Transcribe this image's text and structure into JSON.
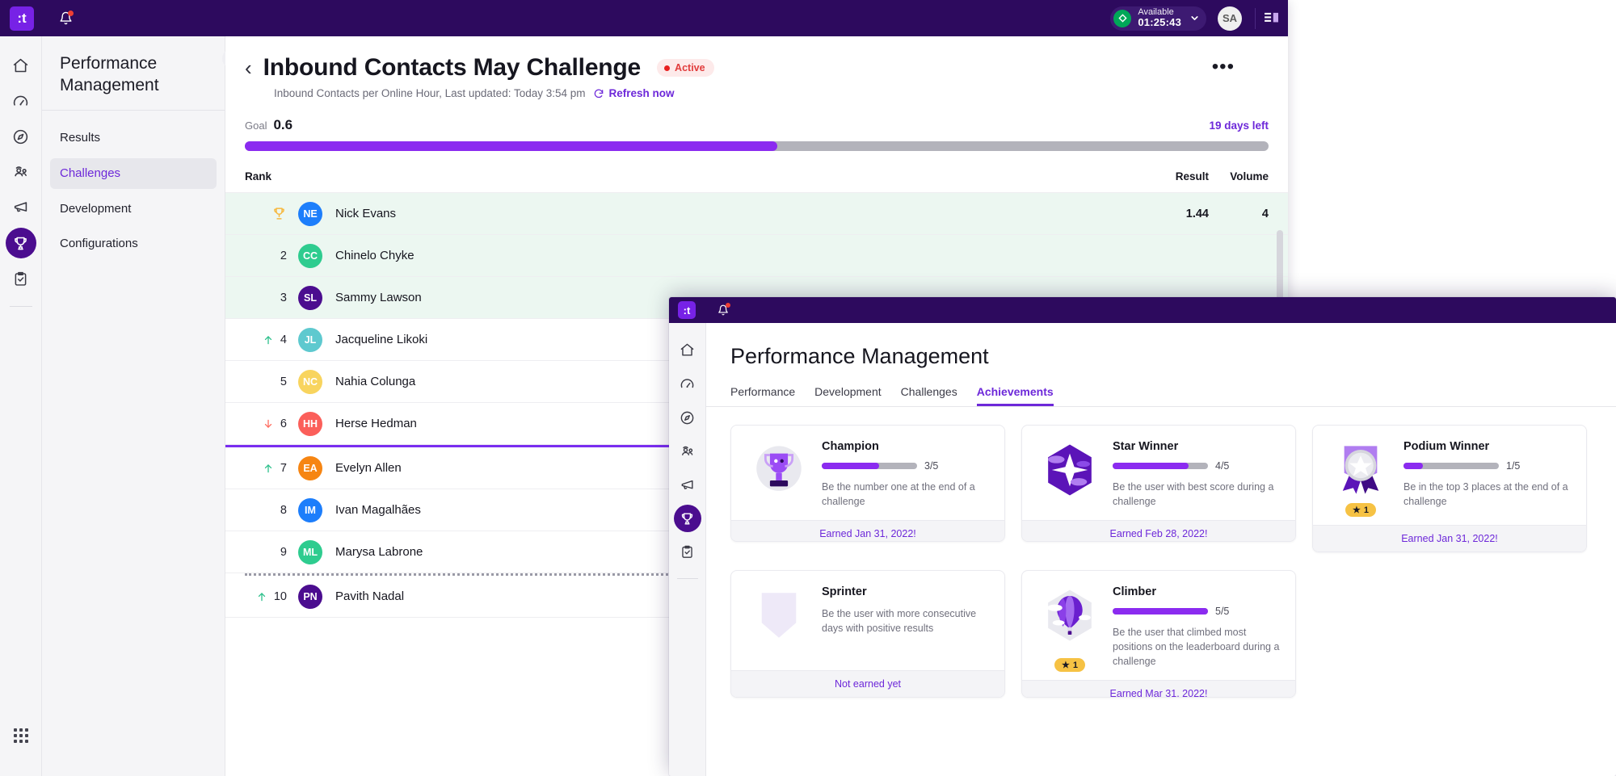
{
  "window1": {
    "topbar": {
      "logo_text": ":t",
      "notifications_icon": "bell-icon",
      "status": {
        "label": "Available",
        "time": "01:25:43",
        "chevron": "chevron-down-icon"
      },
      "avatar_initials": "SA",
      "panel_toggle_icon": "panel-toggle-icon"
    },
    "rail_icons": [
      "home-icon",
      "gauge-icon",
      "compass-icon",
      "people-icon",
      "megaphone-icon",
      "trophy-icon",
      "clipboard-check-icon",
      "apps-grid-icon"
    ],
    "sidebar": {
      "title": "Performance Management",
      "collapse_icon": "collapse-left-icon",
      "items": [
        {
          "label": "Results",
          "selected": false
        },
        {
          "label": "Challenges",
          "selected": true
        },
        {
          "label": "Development",
          "selected": false
        },
        {
          "label": "Configurations",
          "selected": false
        }
      ]
    },
    "header": {
      "back_icon": "chevron-left-icon",
      "title": "Inbound Contacts May Challenge",
      "status_badge": "Active",
      "subtitle": "Inbound Contacts per Online Hour, Last updated: Today 3:54 pm",
      "refresh_label": "Refresh now",
      "refresh_icon": "refresh-icon",
      "more_icon": "more-options-icon"
    },
    "goal": {
      "label": "Goal",
      "value": "0.6",
      "days_left": "19 days left",
      "progress_percent": 52
    },
    "leaderboard": {
      "columns": {
        "rank": "Rank",
        "result": "Result",
        "volume": "Volume"
      },
      "rows": [
        {
          "rank": "1",
          "trend": "trophy",
          "initials": "NE",
          "color": "#1d7efb",
          "name": "Nick Evans",
          "result": "1.44",
          "volume": "4",
          "top3": true
        },
        {
          "rank": "2",
          "trend": "none",
          "initials": "CC",
          "color": "#2ecc8f",
          "name": "Chinelo Chyke",
          "result": "",
          "volume": "",
          "top3": true
        },
        {
          "rank": "3",
          "trend": "none",
          "initials": "SL",
          "color": "#4b0d8f",
          "name": "Sammy Lawson",
          "result": "",
          "volume": "",
          "top3": true
        },
        {
          "rank": "4",
          "trend": "up",
          "initials": "JL",
          "color": "#5ec9cf",
          "name": "Jacqueline Likoki",
          "result": "",
          "volume": "",
          "top3": false
        },
        {
          "rank": "5",
          "trend": "none",
          "initials": "NC",
          "color": "#f8d45e",
          "name": "Nahia Colunga",
          "result": "",
          "volume": "",
          "top3": false
        },
        {
          "rank": "6",
          "trend": "down",
          "initials": "HH",
          "color": "#fb5f5a",
          "name": "Herse Hedman",
          "result": "",
          "volume": "",
          "top3": false
        },
        {
          "rank": "7",
          "trend": "up",
          "initials": "EA",
          "color": "#f68512",
          "name": "Evelyn Allen",
          "result": "",
          "volume": "",
          "top3": false
        },
        {
          "rank": "8",
          "trend": "none",
          "initials": "IM",
          "color": "#1d7efb",
          "name": "Ivan Magalhães",
          "result": "",
          "volume": "",
          "top3": false
        },
        {
          "rank": "9",
          "trend": "none",
          "initials": "ML",
          "color": "#2ecc8f",
          "name": "Marysa Labrone",
          "result": "",
          "volume": "",
          "top3": false
        },
        {
          "rank": "10",
          "trend": "up",
          "initials": "PN",
          "color": "#4b0d8f",
          "name": "Pavith Nadal",
          "result": "",
          "volume": "",
          "top3": false
        }
      ]
    }
  },
  "window2": {
    "topbar": {
      "logo_text": ":t",
      "notifications_icon": "bell-icon"
    },
    "rail_icons": [
      "home-icon",
      "gauge-icon",
      "compass-icon",
      "people-icon",
      "megaphone-icon",
      "trophy-icon",
      "clipboard-check-icon"
    ],
    "title": "Performance Management",
    "tabs": [
      {
        "label": "Performance",
        "selected": false
      },
      {
        "label": "Development",
        "selected": false
      },
      {
        "label": "Challenges",
        "selected": false
      },
      {
        "label": "Achievements",
        "selected": true
      }
    ],
    "achievements": [
      {
        "name": "Champion",
        "icon": "trophy-badge-icon",
        "progress_current": 3,
        "progress_total": 5,
        "progress_text": "3/5",
        "description": "Be the number one at the end of a challenge",
        "footer": "Earned Jan 31, 2022!",
        "earned": true,
        "star_count": null
      },
      {
        "name": "Star Winner",
        "icon": "star-badge-icon",
        "progress_current": 4,
        "progress_total": 5,
        "progress_text": "4/5",
        "description": "Be the user with best score during a challenge",
        "footer": "Earned Feb 28, 2022!",
        "earned": true,
        "star_count": null
      },
      {
        "name": "Podium Winner",
        "icon": "medal-badge-icon",
        "progress_current": 1,
        "progress_total": 5,
        "progress_text": "1/5",
        "description": "Be in the top 3 places at the end of a challenge",
        "footer": "Earned Jan 31, 2022!",
        "earned": true,
        "star_count": "1"
      },
      {
        "name": "Sprinter",
        "icon": "shield-badge-icon",
        "progress_current": 0,
        "progress_total": 5,
        "progress_text": "",
        "description": "Be the user with more consecutive days with positive results",
        "footer": "Not earned yet",
        "earned": false,
        "star_count": null
      },
      {
        "name": "Climber",
        "icon": "balloon-badge-icon",
        "progress_current": 5,
        "progress_total": 5,
        "progress_text": "5/5",
        "description": "Be the user that climbed most positions on the leaderboard during a challenge",
        "footer": "Earned Mar 31, 2022!",
        "earned": true,
        "star_count": "1"
      }
    ]
  },
  "colors": {
    "brand_purple": "#4b0d8f",
    "accent_purple": "#6d28d9",
    "progress_purple": "#8b2bf0",
    "topbar": "#2d0a5e",
    "top3_row": "#ecf7f1",
    "status_green": "#00a758",
    "active_red": "#e81f1f",
    "star_yellow": "#f6c244"
  }
}
